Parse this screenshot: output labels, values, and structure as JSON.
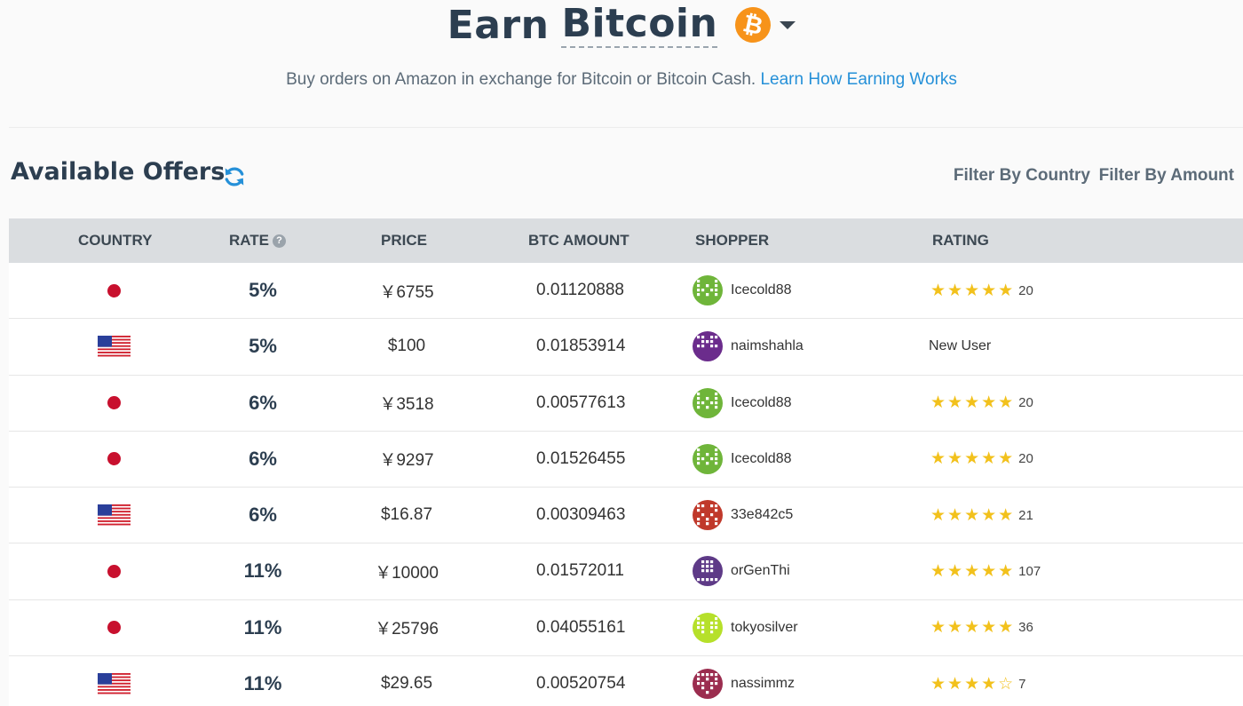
{
  "hero": {
    "title_word": "Earn",
    "title_coin": "Bitcoin",
    "coin_glyph": "₿",
    "subtitle": "Buy orders on Amazon in exchange for Bitcoin or Bitcoin Cash.",
    "learn_link": "Learn How Earning Works"
  },
  "offers": {
    "title": "Available Offers",
    "filter_country": "Filter By Country",
    "filter_amount": "Filter By Amount"
  },
  "columns": {
    "country": "COUNTRY",
    "rate": "RATE",
    "price": "PRICE",
    "btc_amount": "BTC AMOUNT",
    "shopper": "SHOPPER",
    "rating": "RATING"
  },
  "colors": {
    "accent_link": "#2590d8",
    "bitcoin_orange": "#f7931a",
    "star_yellow": "#f2c11c",
    "header_gray": "#dadde0"
  },
  "rows": [
    {
      "country": "jp",
      "rate": "5%",
      "price": "￥6755",
      "btc": "0.01120888",
      "shopper": "Icecold88",
      "avatar_color": "#6fb53a",
      "stars": 5,
      "rating": "20"
    },
    {
      "country": "us",
      "rate": "5%",
      "price": "$100",
      "btc": "0.01853914",
      "shopper": "naimshahla",
      "avatar_color": "#6b2c8c",
      "stars": 0,
      "rating": "New User"
    },
    {
      "country": "jp",
      "rate": "6%",
      "price": "￥3518",
      "btc": "0.00577613",
      "shopper": "Icecold88",
      "avatar_color": "#6fb53a",
      "stars": 5,
      "rating": "20"
    },
    {
      "country": "jp",
      "rate": "6%",
      "price": "￥9297",
      "btc": "0.01526455",
      "shopper": "Icecold88",
      "avatar_color": "#6fb53a",
      "stars": 5,
      "rating": "20"
    },
    {
      "country": "us",
      "rate": "6%",
      "price": "$16.87",
      "btc": "0.00309463",
      "shopper": "33e842c5",
      "avatar_color": "#c0392b",
      "stars": 5,
      "rating": "21"
    },
    {
      "country": "jp",
      "rate": "11%",
      "price": "￥10000",
      "btc": "0.01572011",
      "shopper": "orGenThi",
      "avatar_color": "#5e3a87",
      "stars": 5,
      "rating": "107"
    },
    {
      "country": "jp",
      "rate": "11%",
      "price": "￥25796",
      "btc": "0.04055161",
      "shopper": "tokyosilver",
      "avatar_color": "#b6e02a",
      "stars": 5,
      "rating": "36"
    },
    {
      "country": "us",
      "rate": "11%",
      "price": "$29.65",
      "btc": "0.00520754",
      "shopper": "nassimmz",
      "avatar_color": "#9b2d4f",
      "stars": 4,
      "rating": "7"
    }
  ]
}
